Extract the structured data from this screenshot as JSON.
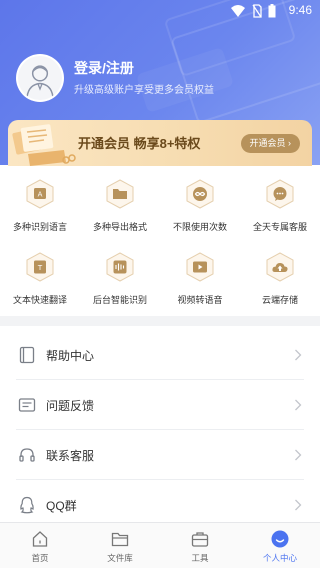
{
  "statusbar": {
    "time": "9:46"
  },
  "profile": {
    "login_title": "登录/注册",
    "login_subtitle": "升级高级账户享受更多会员权益"
  },
  "vip": {
    "promo_text": "开通会员 畅享8+特权",
    "button_label": "开通会员 ›"
  },
  "features": [
    {
      "label": "多种识别语言",
      "icon": "language-icon"
    },
    {
      "label": "多种导出格式",
      "icon": "folder-icon"
    },
    {
      "label": "不限使用次数",
      "icon": "infinity-icon"
    },
    {
      "label": "全天专属客服",
      "icon": "chat-icon"
    },
    {
      "label": "文本快速翻译",
      "icon": "translate-icon"
    },
    {
      "label": "后台智能识别",
      "icon": "waveform-icon"
    },
    {
      "label": "视频转语音",
      "icon": "video-icon"
    },
    {
      "label": "云端存储",
      "icon": "cloud-upload-icon"
    }
  ],
  "menu": [
    {
      "label": "帮助中心",
      "icon": "book-icon"
    },
    {
      "label": "问题反馈",
      "icon": "feedback-icon"
    },
    {
      "label": "联系客服",
      "icon": "headset-icon"
    },
    {
      "label": "QQ群",
      "icon": "qq-icon"
    }
  ],
  "tabs": [
    {
      "label": "首页",
      "icon": "home-icon"
    },
    {
      "label": "文件库",
      "icon": "folder-icon"
    },
    {
      "label": "工具",
      "icon": "toolbox-icon"
    },
    {
      "label": "个人中心",
      "icon": "profile-icon",
      "active": true
    }
  ],
  "colors": {
    "accent": "#4b73f0",
    "header": "#6680ec",
    "vip_gold": "#b7925b",
    "hex_icon": "#b7925b"
  }
}
